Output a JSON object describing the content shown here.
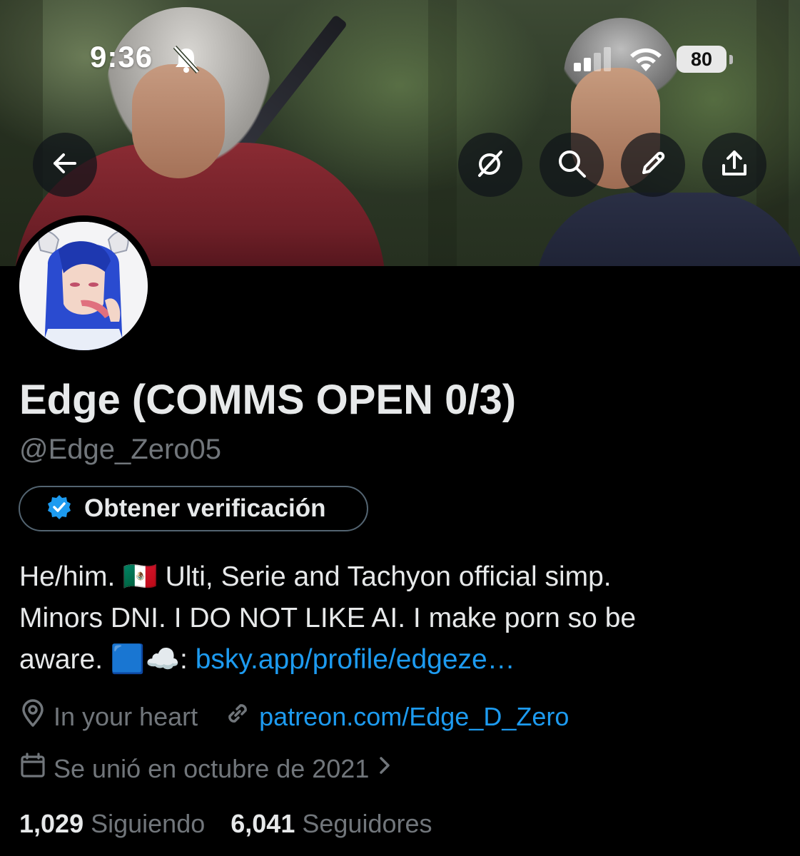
{
  "status_bar": {
    "time": "9:36",
    "battery": "80",
    "icons": [
      "bell-slash-icon",
      "cellular-signal-icon",
      "wifi-icon",
      "battery-icon"
    ]
  },
  "nav": {
    "icons": [
      "back-arrow-icon",
      "grok-icon",
      "search-icon",
      "pencil-icon",
      "share-icon"
    ]
  },
  "profile": {
    "display_name": "Edge (COMMS OPEN 0/3)",
    "handle": "@Edge_Zero05",
    "verify_button_label": "Obtener verificación",
    "bio": {
      "line1": "He/him. 🇲🇽 Ulti, Serie and Tachyon official simp.",
      "line2": "Minors DNI. I DO NOT LIKE AI. I make porn so be",
      "line3_prefix": "aware. 🟦☁️: ",
      "line3_link": "bsky.app/profile/edgeze…"
    },
    "location": "In your heart",
    "website": "patreon.com/Edge_D_Zero",
    "joined": "Se unió en octubre de 2021",
    "following_count": "1,029",
    "following_label": "Siguiendo",
    "followers_count": "6,041",
    "followers_label": "Seguidores"
  },
  "colors": {
    "background": "#000000",
    "text_primary": "#e7e9ea",
    "text_secondary": "#71767b",
    "link": "#1d9bf0",
    "verified_badge": "#1d9bf0"
  }
}
